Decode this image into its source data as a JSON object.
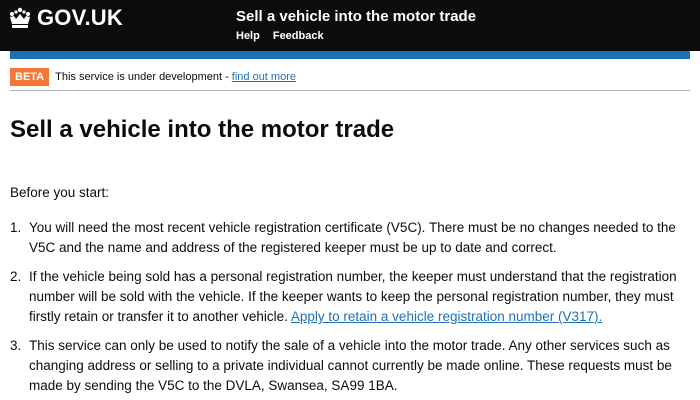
{
  "header": {
    "logo_text": "GOV.UK",
    "service_name": "Sell a vehicle into the motor trade",
    "nav": [
      "Help",
      "Feedback"
    ],
    "logo_icon": "crown-icon",
    "colors": {
      "header_bg": "#0b0c0c",
      "accent_bar": "#1d70b8"
    }
  },
  "phase_banner": {
    "tag": "BETA",
    "text": "This service is under development -",
    "link": "find out more",
    "tag_color": "#f47738"
  },
  "main": {
    "title": "Sell a vehicle into the motor trade",
    "intro": "Before you start:",
    "steps": [
      {
        "number": "1.",
        "text": "You will need the most recent vehicle registration certificate (V5C). There must be no changes needed to the V5C and the name and address of the registered keeper must be up to date and correct.",
        "link": ""
      },
      {
        "number": "2.",
        "text": "If the vehicle being sold has a personal registration number, the keeper must understand that the registration number will be sold with the vehicle. If the keeper wants to keep the personal registration number, they must firstly retain or transfer it to another vehicle. ",
        "link": "Apply to retain a vehicle registration number (V317)."
      },
      {
        "number": "3.",
        "text": "This service can only be used to notify the sale of a vehicle into the motor trade. Any other services such as changing address or selling to a private individual cannot currently be made online. These requests must be made by sending the V5C to the DVLA, Swansea, SA99 1BA.",
        "link": ""
      }
    ],
    "link_color": "#1d70b8"
  }
}
